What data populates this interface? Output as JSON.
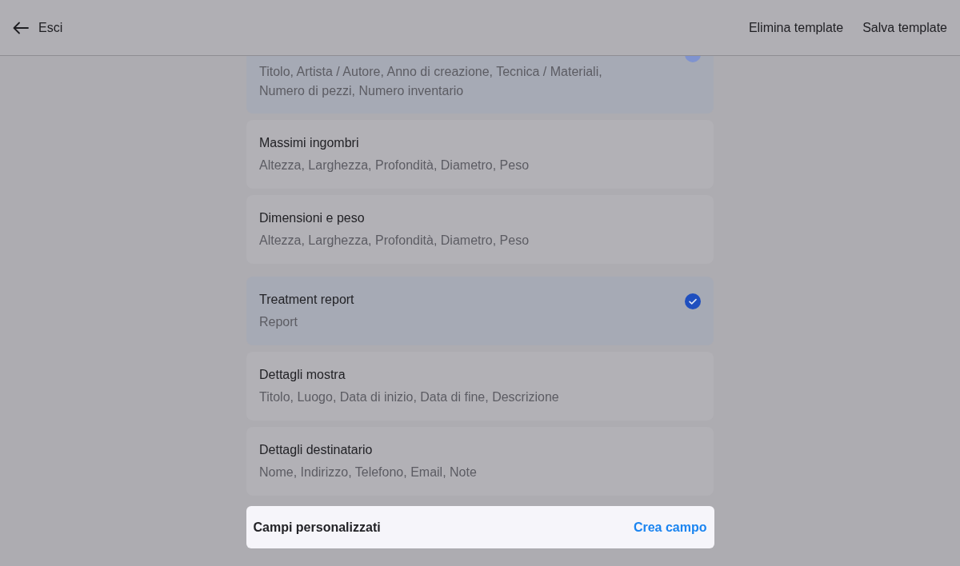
{
  "header": {
    "back_label": "Esci",
    "actions": [
      "Elimina template",
      "Salva template"
    ]
  },
  "sections": [
    {
      "kind": "cut",
      "fields": "Titolo, Artista / Autore, Anno di creazione, Tecnica / Materiali, Numero di pezzi, Numero inventario",
      "selected": true
    },
    {
      "kind": "card",
      "title": "Massimi ingombri",
      "fields": "Altezza, Larghezza, Profondità, Diametro, Peso",
      "selected": false
    },
    {
      "kind": "card",
      "title": "Dimensioni e peso",
      "fields": "Altezza, Larghezza, Profondità, Diametro, Peso",
      "selected": false
    },
    {
      "kind": "card",
      "title": "Treatment report",
      "fields": "Report",
      "selected": true
    },
    {
      "kind": "card",
      "title": "Dettagli mostra",
      "fields": "Titolo, Luogo, Data di inizio, Data di fine, Descrizione",
      "selected": false
    },
    {
      "kind": "card",
      "title": "Dettagli destinatario",
      "fields": "Nome, Indirizzo, Telefono, Email, Note",
      "selected": false
    }
  ],
  "custom_fields": {
    "label": "Campi personalizzati",
    "action": "Crea campo"
  }
}
